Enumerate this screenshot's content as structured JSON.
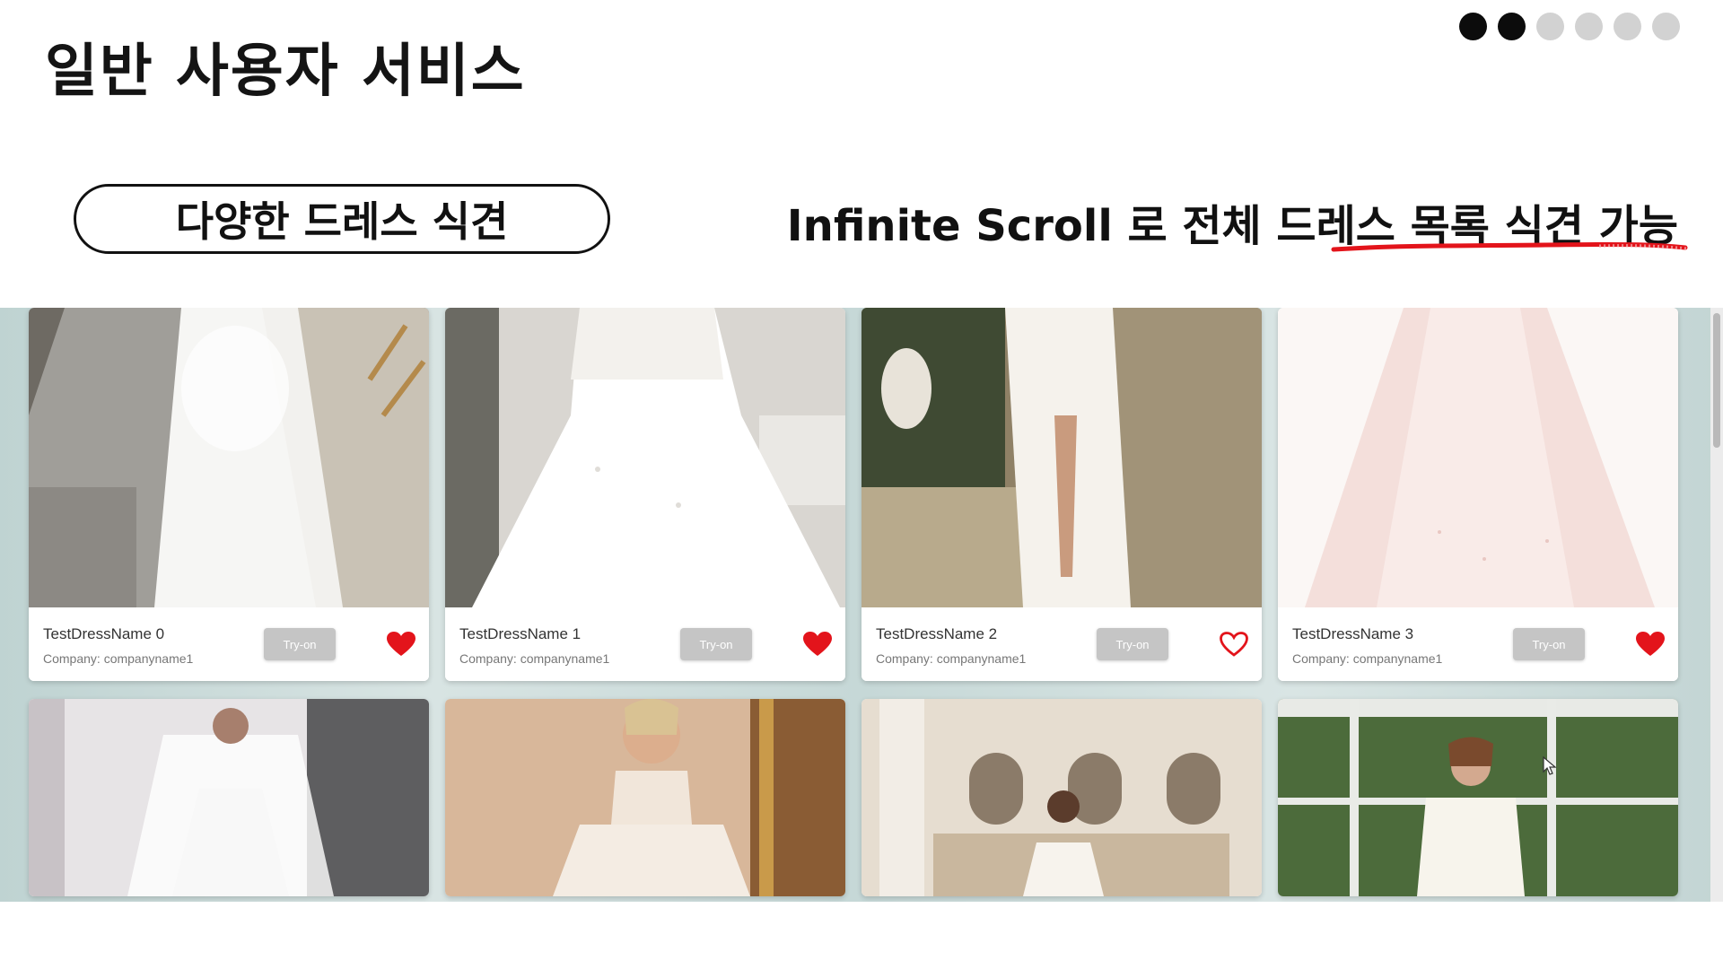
{
  "slide": {
    "title": "일반 사용자 서비스",
    "pagination": {
      "total": 6,
      "active": 2
    },
    "section_label": "다양한 드레스 식견",
    "caption_prefix": "Infinite Scroll 로 전체 ",
    "caption_highlight": "드레스 목록 식견 가능",
    "accent_color": "#e3141b"
  },
  "dress_grid": {
    "cards": [
      {
        "name": "TestDressName 0",
        "company": "Company: companyname1",
        "try_on_label": "Try-on",
        "favorited": true
      },
      {
        "name": "TestDressName 1",
        "company": "Company: companyname1",
        "try_on_label": "Try-on",
        "favorited": true
      },
      {
        "name": "TestDressName 2",
        "company": "Company: companyname1",
        "try_on_label": "Try-on",
        "favorited": false
      },
      {
        "name": "TestDressName 3",
        "company": "Company: companyname1",
        "try_on_label": "Try-on",
        "favorited": true
      }
    ],
    "heart_color": "#e3141b",
    "try_on_color": "#c5c5c5"
  }
}
